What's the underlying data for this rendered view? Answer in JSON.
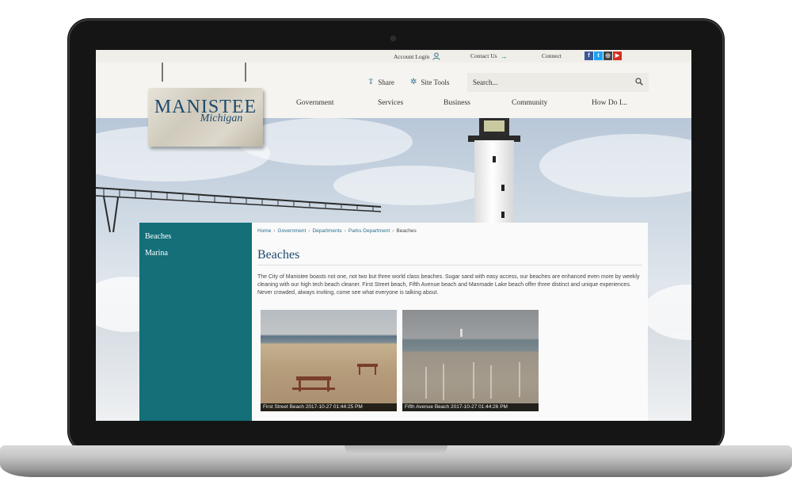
{
  "utility": {
    "account_login": "Account Login",
    "contact_us": "Contact Us",
    "connect": "Connect",
    "social": [
      {
        "icon": "facebook-icon",
        "glyph": "f",
        "color": "#3b5998"
      },
      {
        "icon": "twitter-icon",
        "glyph": "t",
        "color": "#1da1f2"
      },
      {
        "icon": "instagram-icon",
        "glyph": "◎",
        "color": "#444444"
      },
      {
        "icon": "youtube-icon",
        "glyph": "▶",
        "color": "#d62d20"
      }
    ]
  },
  "header": {
    "share": "Share",
    "site_tools": "Site Tools",
    "search_placeholder": "Search..."
  },
  "logo": {
    "title": "MANISTEE",
    "subtitle": "Michigan"
  },
  "nav": [
    "Government",
    "Services",
    "Business",
    "Community",
    "How Do I..."
  ],
  "sidebar": {
    "items": [
      "Beaches",
      "Marina"
    ]
  },
  "breadcrumb": [
    "Home",
    "Government",
    "Departments",
    "Parks Department",
    "Beaches"
  ],
  "page": {
    "title": "Beaches",
    "intro": "The City of Manistee boasts not one, not two but three world class beaches. Sugar sand with easy access, our beaches are enhanced even more by weekly cleaning with our high tech beach cleaner. First Street beach, Fifth Avenue beach and Manmade Lake beach offer three distinct and unique experiences. Never crowded, always inviting, come see what everyone is talking about."
  },
  "webcams": [
    {
      "caption": "First Street Beach 2017-10-27 01:44:25 PM"
    },
    {
      "caption": "Fifth Avenue Beach 2017-10-27 01:44:26 PM"
    }
  ],
  "colors": {
    "accent_teal": "#146f79",
    "heading_blue": "#1d4a6d",
    "link_blue": "#2a6f8f"
  }
}
